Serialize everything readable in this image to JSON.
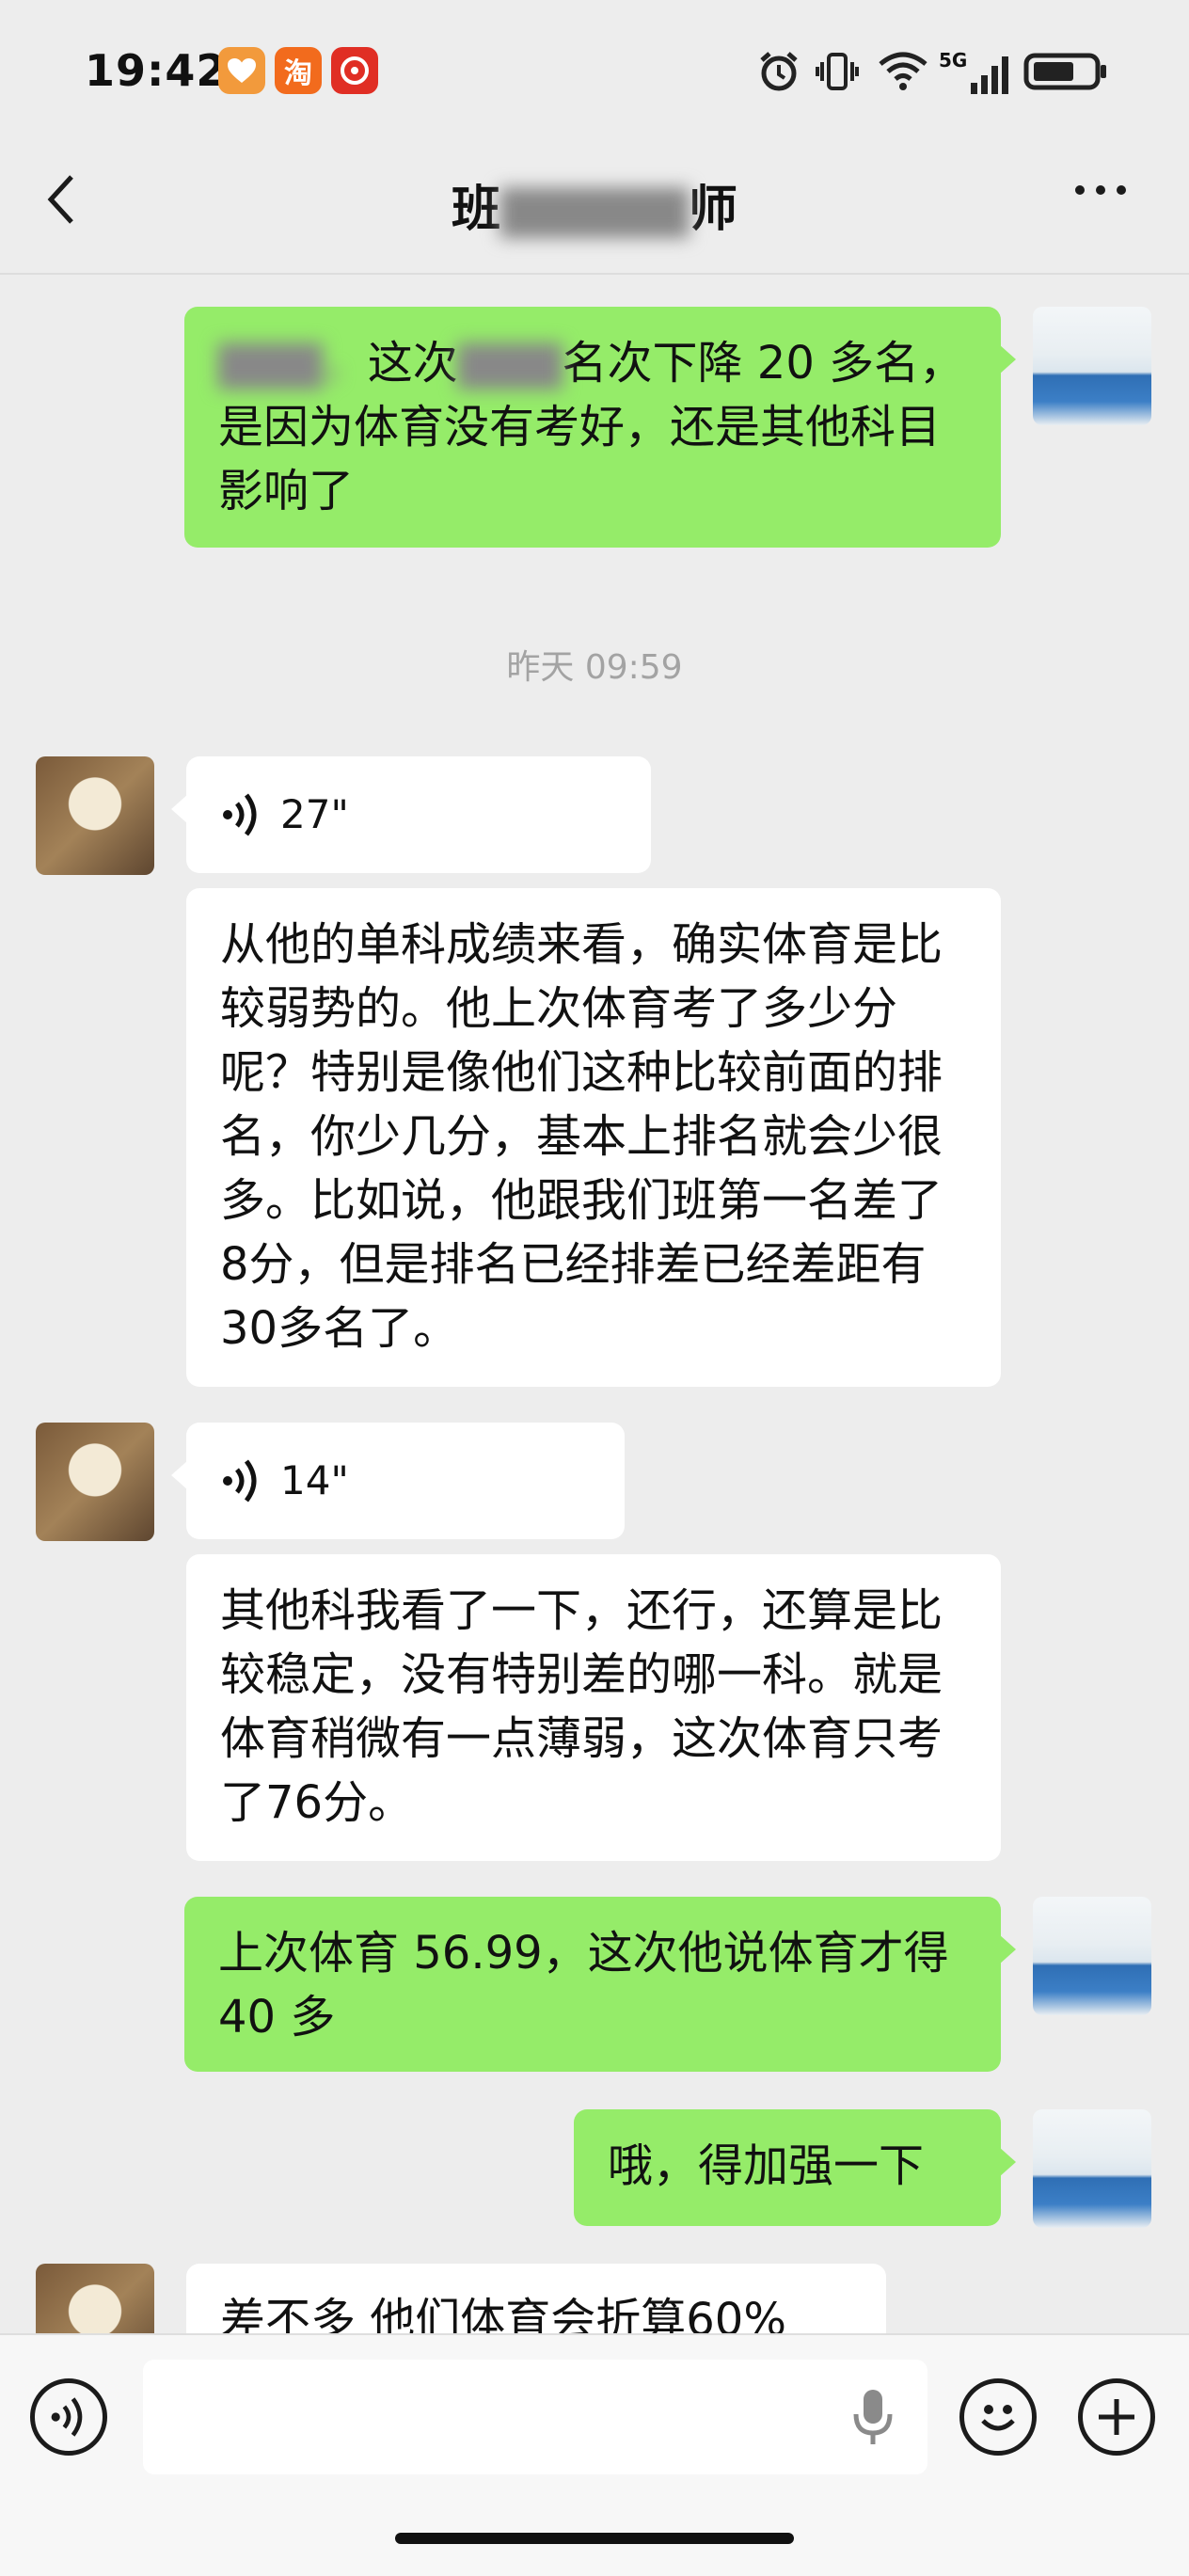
{
  "status_bar": {
    "time": "19:42",
    "apps": [
      {
        "name": "health-app-icon",
        "color": "#f29a3c"
      },
      {
        "name": "taobao-app-icon",
        "label": "淘",
        "color": "#f26b1d"
      },
      {
        "name": "pinduoduo-app-icon",
        "color": "#e02e24"
      }
    ],
    "network": "5G"
  },
  "header": {
    "title_visible": "班",
    "title_tail": "师"
  },
  "messages": [
    {
      "side": "right",
      "text": "这次",
      "text2": "名次下降 20 多名，是因为体育没有考好，还是其他科目影响了"
    },
    {
      "type": "timestamp",
      "text": "昨天 09:59"
    },
    {
      "side": "left",
      "voice_duration": "27\""
    },
    {
      "side": "left",
      "text": "从他的单科成绩来看，确实体育是比较弱势的。他上次体育考了多少分呢？特别是像他们这种比较前面的排名，你少几分，基本上排名就会少很多。比如说，他跟我们班第一名差了8分，但是排名已经排差已经差距有30多名了。"
    },
    {
      "side": "left",
      "voice_duration": "14\""
    },
    {
      "side": "left",
      "text": "其他科我看了一下，还行，还算是比较稳定，没有特别差的哪一科。就是体育稍微有一点薄弱，这次体育只考了76分。"
    },
    {
      "side": "right",
      "text": "上次体育 56.99，这次他说体育才得 40 多"
    },
    {
      "side": "right",
      "text": "哦，得加强一下"
    },
    {
      "side": "left",
      "text": "差不多 他们体育会折算60%"
    }
  ],
  "colors": {
    "bubble_self": "#95ec69",
    "bubble_other": "#ffffff",
    "background": "#ededed"
  }
}
